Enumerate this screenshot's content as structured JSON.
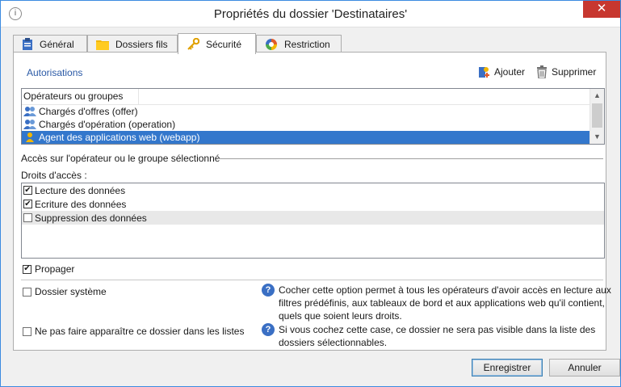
{
  "window": {
    "title": "Propriétés du dossier 'Destinataires'",
    "close_glyph": "✕",
    "app_icon": "i"
  },
  "tabs": [
    {
      "label": "Général",
      "icon": "clipboard-icon",
      "active": false
    },
    {
      "label": "Dossiers fils",
      "icon": "folder-icon",
      "active": false
    },
    {
      "label": "Sécurité",
      "icon": "key-icon",
      "active": true
    },
    {
      "label": "Restriction",
      "icon": "restriction-icon",
      "active": false
    }
  ],
  "authorizations": {
    "section_title": "Autorisations",
    "add_label": "Ajouter",
    "delete_label": "Supprimer",
    "column_header": "Opérateurs ou groupes",
    "items": [
      {
        "label": "Chargés d'offres (offer)",
        "icon": "group-icon",
        "selected": false
      },
      {
        "label": "Chargés d'opération (operation)",
        "icon": "group-icon",
        "selected": false
      },
      {
        "label": "Agent des applications web (webapp)",
        "icon": "operator-icon",
        "selected": true
      }
    ]
  },
  "access": {
    "group_label": "Accès sur l'opérateur ou le groupe sélectionné",
    "rights_label": "Droits d'accès :",
    "rights": [
      {
        "label": "Lecture des données",
        "checked": true
      },
      {
        "label": "Ecriture des données",
        "checked": true
      },
      {
        "label": "Suppression des données",
        "checked": false
      }
    ],
    "propagate_label": "Propager",
    "propagate_checked": true
  },
  "options": {
    "system_folder_label": "Dossier système",
    "system_folder_checked": false,
    "system_folder_help": "Cocher cette option permet à tous les opérateurs d'avoir accès en lecture aux filtres prédéfinis, aux tableaux de bord et aux applications web qu'il contient, quels que soient leurs droits.",
    "hide_folder_label": "Ne pas faire apparaître ce dossier dans les listes",
    "hide_folder_checked": false,
    "hide_folder_help": "Si vous cochez cette case, ce dossier ne sera pas visible dans la liste des dossiers sélectionnables."
  },
  "buttons": {
    "save_label": "Enregistrer",
    "cancel_label": "Annuler"
  },
  "colors": {
    "accent": "#3377cc",
    "section_title": "#2b5aa6",
    "close": "#c7372f"
  }
}
